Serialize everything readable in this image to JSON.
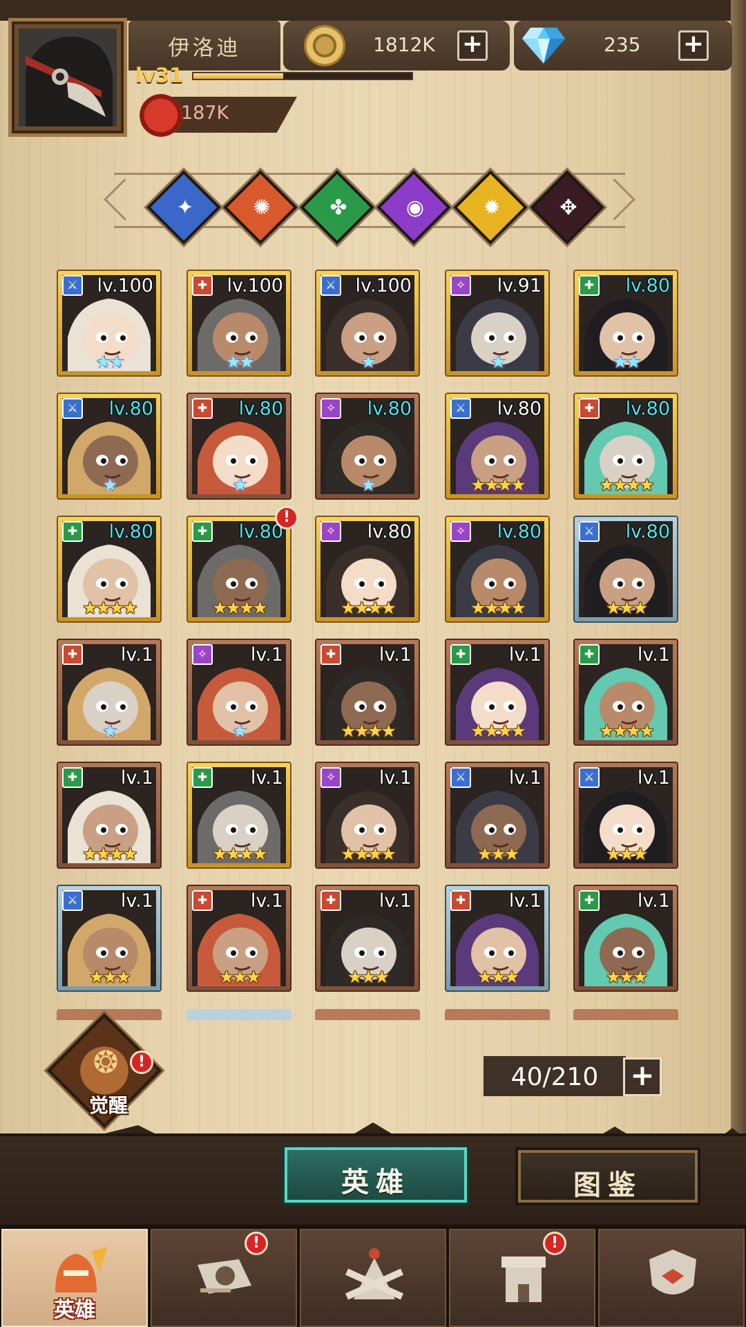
{
  "player": {
    "name": "伊洛迪",
    "level": "lv31",
    "xp_fraction": 0.41,
    "power": "187K"
  },
  "resources": {
    "gold": "1812K",
    "gems": "235",
    "plus": "+"
  },
  "factions": [
    {
      "name": "faction-1",
      "color": "#3a67c9",
      "glyph": "✦"
    },
    {
      "name": "faction-2",
      "color": "#d9582c",
      "glyph": "✺"
    },
    {
      "name": "faction-3",
      "color": "#2b9a48",
      "glyph": "✤"
    },
    {
      "name": "faction-4",
      "color": "#8d3bc9",
      "glyph": "◉"
    },
    {
      "name": "faction-5",
      "color": "#e8b320",
      "glyph": "✹"
    },
    {
      "name": "faction-6",
      "color": "#3b1c24",
      "glyph": "✥"
    }
  ],
  "heroes": [
    {
      "level": "lv.100",
      "frame": "gold",
      "class_color": "#3a6fd0",
      "stars": 2,
      "rainbow": true
    },
    {
      "level": "lv.100",
      "frame": "gold",
      "class_color": "#c94a32",
      "stars": 2,
      "rainbow": true
    },
    {
      "level": "lv.100",
      "frame": "gold",
      "class_color": "#3a6fd0",
      "stars": 1,
      "rainbow": true
    },
    {
      "level": "lv.91",
      "frame": "gold",
      "class_color": "#9a45c8",
      "stars": 1,
      "rainbow": true
    },
    {
      "level": "lv.80",
      "frame": "gold",
      "class_color": "#2b9a48",
      "stars": 2,
      "rainbow": true,
      "cyan": true
    },
    {
      "level": "lv.80",
      "frame": "gold",
      "class_color": "#3a6fd0",
      "stars": 1,
      "rainbow": true,
      "cyan": true
    },
    {
      "level": "lv.80",
      "frame": "bronze",
      "class_color": "#c94a32",
      "stars": 1,
      "rainbow": true,
      "cyan": true
    },
    {
      "level": "lv.80",
      "frame": "bronze",
      "class_color": "#9a45c8",
      "stars": 1,
      "rainbow": true,
      "cyan": true
    },
    {
      "level": "lv.80",
      "frame": "gold",
      "class_color": "#3a6fd0",
      "stars": 4
    },
    {
      "level": "lv.80",
      "frame": "gold",
      "class_color": "#c94a32",
      "stars": 4,
      "cyan": true
    },
    {
      "level": "lv.80",
      "frame": "gold",
      "class_color": "#2b9a48",
      "stars": 4,
      "cyan": true
    },
    {
      "level": "lv.80",
      "frame": "gold",
      "class_color": "#2b9a48",
      "stars": 4,
      "cyan": true,
      "alert": true
    },
    {
      "level": "lv.80",
      "frame": "gold",
      "class_color": "#9a45c8",
      "stars": 4
    },
    {
      "level": "lv.80",
      "frame": "gold",
      "class_color": "#9a45c8",
      "stars": 4,
      "cyan": true
    },
    {
      "level": "lv.80",
      "frame": "blue",
      "class_color": "#3a6fd0",
      "stars": 3,
      "cyan": true
    },
    {
      "level": "lv.1",
      "frame": "bronze",
      "class_color": "#c94a32",
      "stars": 1,
      "rainbow": true
    },
    {
      "level": "lv.1",
      "frame": "bronze",
      "class_color": "#9a45c8",
      "stars": 1,
      "rainbow": true
    },
    {
      "level": "lv.1",
      "frame": "bronze",
      "class_color": "#c94a32",
      "stars": 4
    },
    {
      "level": "lv.1",
      "frame": "bronze",
      "class_color": "#2b9a48",
      "stars": 4
    },
    {
      "level": "lv.1",
      "frame": "bronze",
      "class_color": "#2b9a48",
      "stars": 4
    },
    {
      "level": "lv.1",
      "frame": "bronze",
      "class_color": "#2b9a48",
      "stars": 4
    },
    {
      "level": "lv.1",
      "frame": "gold",
      "class_color": "#2b9a48",
      "stars": 4
    },
    {
      "level": "lv.1",
      "frame": "bronze",
      "class_color": "#9a45c8",
      "stars": 4
    },
    {
      "level": "lv.1",
      "frame": "bronze",
      "class_color": "#3a6fd0",
      "stars": 3
    },
    {
      "level": "lv.1",
      "frame": "bronze",
      "class_color": "#3a6fd0",
      "stars": 3
    },
    {
      "level": "lv.1",
      "frame": "blue",
      "class_color": "#3a6fd0",
      "stars": 3
    },
    {
      "level": "lv.1",
      "frame": "bronze",
      "class_color": "#c94a32",
      "stars": 3
    },
    {
      "level": "lv.1",
      "frame": "bronze",
      "class_color": "#c94a32",
      "stars": 3
    },
    {
      "level": "lv.1",
      "frame": "blue",
      "class_color": "#c94a32",
      "stars": 3
    },
    {
      "level": "lv.1",
      "frame": "bronze",
      "class_color": "#2b9a48",
      "stars": 3
    }
  ],
  "alert_mark": "!",
  "awaken": {
    "label": "觉醒",
    "glyph": "❂"
  },
  "capacity": {
    "text": "40/210",
    "plus": "+"
  },
  "tabs": {
    "hero": "英雄",
    "atlas": "图鉴"
  },
  "navbar": [
    {
      "label": "英雄",
      "active": true,
      "alert": false
    },
    {
      "label": "",
      "active": false,
      "alert": true
    },
    {
      "label": "",
      "active": false,
      "alert": false
    },
    {
      "label": "",
      "active": false,
      "alert": true
    },
    {
      "label": "",
      "active": false,
      "alert": false
    }
  ]
}
